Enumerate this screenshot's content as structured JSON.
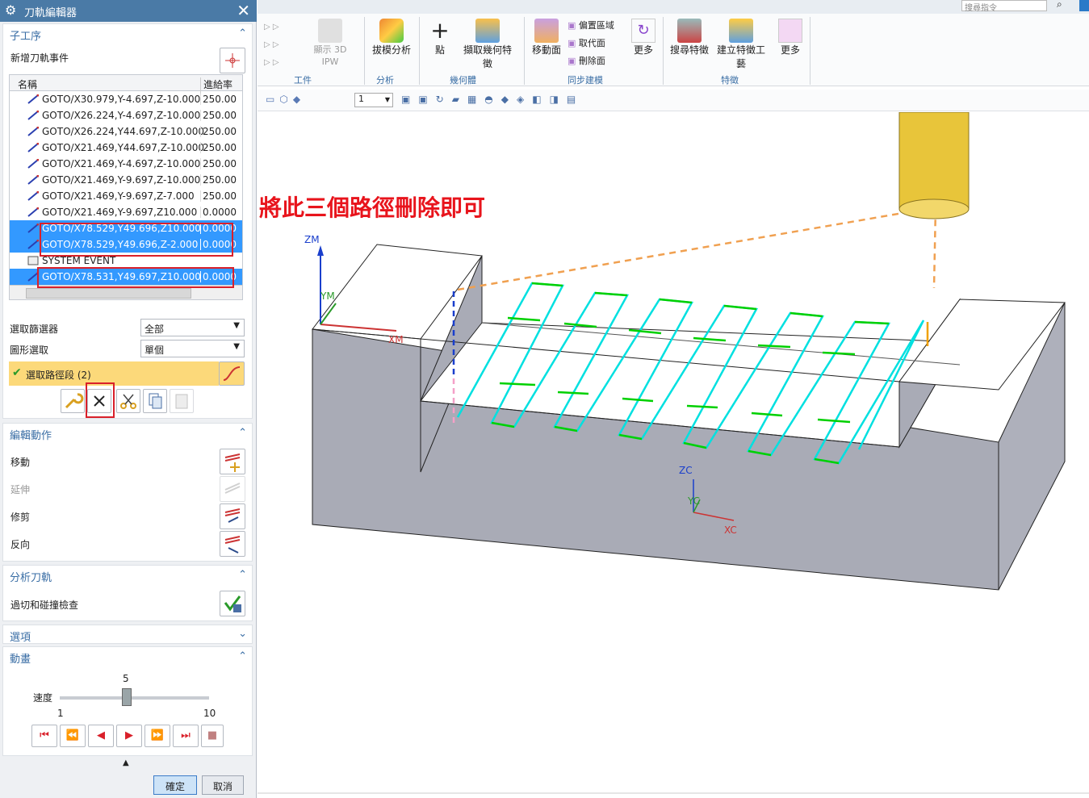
{
  "dialog": {
    "title": "刀軌編輯器"
  },
  "sections": {
    "sub_operation": {
      "title": "子工序",
      "add_event_label": "新增刀軌事件",
      "table": {
        "col_name": "名稱",
        "col_feed": "進給率",
        "rows": [
          {
            "name": "GOTO/X30.979,Y-4.697,Z-10.000",
            "feed": "250.00",
            "selected": false
          },
          {
            "name": "GOTO/X26.224,Y-4.697,Z-10.000",
            "feed": "250.00",
            "selected": false
          },
          {
            "name": "GOTO/X26.224,Y44.697,Z-10.000",
            "feed": "250.00",
            "selected": false
          },
          {
            "name": "GOTO/X21.469,Y44.697,Z-10.000",
            "feed": "250.00",
            "selected": false
          },
          {
            "name": "GOTO/X21.469,Y-4.697,Z-10.000",
            "feed": "250.00",
            "selected": false
          },
          {
            "name": "GOTO/X21.469,Y-9.697,Z-10.000",
            "feed": "250.00",
            "selected": false
          },
          {
            "name": "GOTO/X21.469,Y-9.697,Z-7.000",
            "feed": "250.00",
            "selected": false
          },
          {
            "name": "GOTO/X21.469,Y-9.697,Z10.000",
            "feed": "0.0000",
            "selected": false
          },
          {
            "name": "GOTO/X78.529,Y49.696,Z10.000",
            "feed": "0.0000",
            "selected": true
          },
          {
            "name": "GOTO/X78.529,Y49.696,Z-2.000",
            "feed": "0.0000",
            "selected": true
          },
          {
            "name": "SYSTEM EVENT",
            "feed": "",
            "selected": false
          },
          {
            "name": "GOTO/X78.531,Y49.697,Z10.000",
            "feed": "0.0000",
            "selected": true
          }
        ]
      },
      "filter_label": "選取篩選器",
      "filter_value": "全部",
      "graphic_label": "圖形選取",
      "graphic_value": "單個",
      "select_segments": "選取路徑段 (2)"
    },
    "edit": {
      "title": "編輯動作",
      "move": "移動",
      "extend": "延伸",
      "trim": "修剪",
      "reverse": "反向"
    },
    "analyze": {
      "title": "分析刀軌",
      "gouge_check": "過切和碰撞檢查"
    },
    "options": {
      "title": "選項"
    },
    "animation": {
      "title": "動畫",
      "speed_label": "速度",
      "speed_value": "5",
      "speed_min": "1",
      "speed_max": "10",
      "speed_fraction": 0.45
    }
  },
  "footer": {
    "ok": "確定",
    "cancel": "取消"
  },
  "ribbon": {
    "search_placeholder": "搜尋指令",
    "show_ipw": "顯示 3D IPW",
    "draft_analysis": "拔模分析",
    "point": "點",
    "extract_geometry": "擷取幾何特徵",
    "move_face": "移動面",
    "offset_region": "偏置區域",
    "replace_face": "取代面",
    "delete_face": "刪除面",
    "more1": "更多",
    "search_feature": "搜尋特徵",
    "create_feature_group": "建立特徵工藝",
    "more2": "更多",
    "groups": {
      "workpiece": "工件",
      "analysis": "分析",
      "geometry": "幾何體",
      "sync_modeling": "同步建模",
      "feature": "特徵"
    },
    "toolbar_num": "1"
  },
  "viewport": {
    "annotation": "將此三個路徑刪除即可",
    "axes": {
      "zm": "ZM",
      "ym": "YM",
      "xm": "XM",
      "zc": "ZC",
      "yc": "YC",
      "xc": "XC"
    },
    "colors": {
      "part_side": "#a9abb6",
      "part_top": "#ffffff",
      "toolpath": "#00e0e0",
      "cut": "#00d000",
      "tool": "#e8c53a",
      "rapid": "#f0a050",
      "annotation": "#e8141c"
    }
  }
}
